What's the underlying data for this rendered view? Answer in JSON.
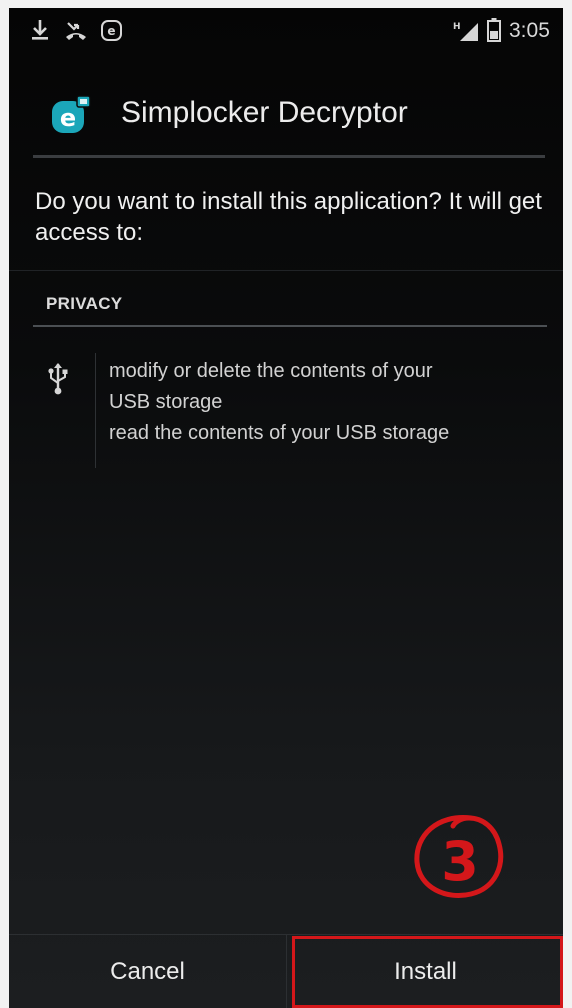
{
  "status_bar": {
    "icons": [
      "download-icon",
      "missed-call-icon",
      "eset-notification-icon",
      "signal-icon",
      "battery-icon"
    ],
    "network_label": "H",
    "time": "3:05"
  },
  "header": {
    "icon": "eset-app-icon",
    "app_name": "Simplocker Decryptor"
  },
  "prompt": "Do you want to install this application? It will get access to:",
  "permissions": {
    "section_title": "PRIVACY",
    "icon": "usb-icon",
    "items": [
      "modify or delete the contents of your USB storage",
      "read the contents of your USB storage"
    ]
  },
  "annotation": {
    "step_number": "3",
    "color": "#d4171a"
  },
  "buttons": {
    "cancel_label": "Cancel",
    "install_label": "Install"
  },
  "colors": {
    "accent_red": "#d4171a",
    "eset_teal": "#1ba6b9"
  }
}
